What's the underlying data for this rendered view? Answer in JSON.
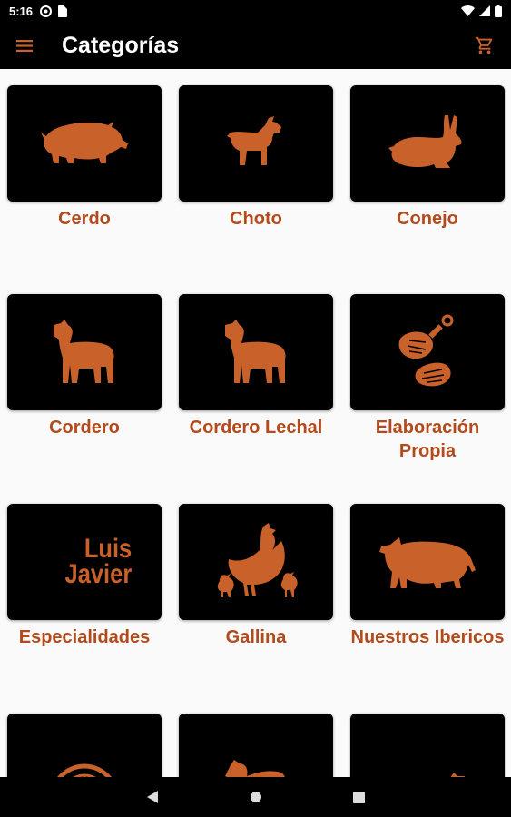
{
  "status_bar": {
    "time": "5:16"
  },
  "app_bar": {
    "title": "Categorías",
    "menu_icon": "hamburger-menu-icon",
    "cart_icon": "shopping-cart-icon"
  },
  "colors": {
    "accent": "#c9612b",
    "label": "#b24a1c",
    "bar": "#000000",
    "background": "#fafafa"
  },
  "categories": [
    {
      "label": "Cerdo",
      "icon": "pig-icon"
    },
    {
      "label": "Choto",
      "icon": "goat-icon"
    },
    {
      "label": "Conejo",
      "icon": "rabbit-icon"
    },
    {
      "label": "Cordero",
      "icon": "lamb-icon"
    },
    {
      "label": "Cordero Lechal",
      "icon": "lamb-icon"
    },
    {
      "label": "Elaboración Propia",
      "icon": "meat-cuts-icon"
    },
    {
      "label": "Especialidades",
      "icon": "luis-javier-logo",
      "logo_text_1": "Luis",
      "logo_text_2": "Javier"
    },
    {
      "label": "Gallina",
      "icon": "hen-with-chicks-icon"
    },
    {
      "label": "Nuestros Ibericos",
      "icon": "iberian-pig-icon"
    },
    {
      "label": "",
      "icon": "grill-icon"
    },
    {
      "label": "",
      "icon": "chicken-icon"
    },
    {
      "label": "",
      "icon": "cow-icon"
    }
  ]
}
